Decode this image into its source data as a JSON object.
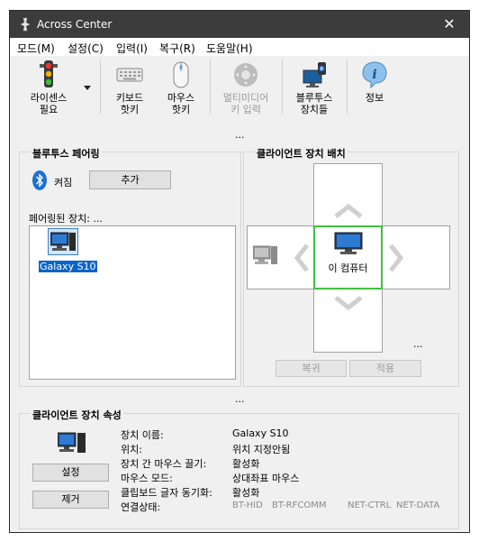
{
  "window": {
    "title": "Across Center",
    "close_glyph": "✕"
  },
  "menu": [
    "모드(M)",
    "설정(C)",
    "입력(I)",
    "복구(R)",
    "도움말(H)"
  ],
  "toolbar": {
    "license": {
      "line1": "라이센스",
      "line2": "필요"
    },
    "keyboard": {
      "line1": "키보드",
      "line2": "핫키"
    },
    "mouse": {
      "line1": "마우스",
      "line2": "핫키"
    },
    "multimedia": {
      "line1": "멀티미디어",
      "line2": "키 입력"
    },
    "bluetooth": {
      "line1": "블루투스",
      "line2": "장치들"
    },
    "info": {
      "line1": "정보"
    }
  },
  "ellipsis": "...",
  "bluetooth_pairing": {
    "title": "블루투스 페어링",
    "state": "켜짐",
    "add_button": "추가",
    "paired_label": "페어링된 장치: ...",
    "devices": [
      {
        "name": "Galaxy S10"
      }
    ]
  },
  "client_layout": {
    "title": "클라이언트 장치 배치",
    "center_label": "이 컴퓨터",
    "restore_button": "복귀",
    "apply_button": "적용"
  },
  "client_props": {
    "title": "클라이언트 장치 속성",
    "settings_button": "설정",
    "remove_button": "제거",
    "rows": [
      {
        "label": "장치 이름:",
        "value": "Galaxy S10"
      },
      {
        "label": "위치:",
        "value": "위치 지정안됨"
      },
      {
        "label": "장치 간 마우스 끌기:",
        "value": "활성화"
      },
      {
        "label": "마우스 모드:",
        "value": "상대좌표 마우스"
      },
      {
        "label": "클립보드 글자 동기화:",
        "value": "활성화"
      },
      {
        "label": "연결상태:",
        "value": ""
      }
    ],
    "connection_flags": [
      "BT-HID",
      "BT-RFCOMM",
      "NET-CTRL",
      "NET-DATA"
    ]
  }
}
